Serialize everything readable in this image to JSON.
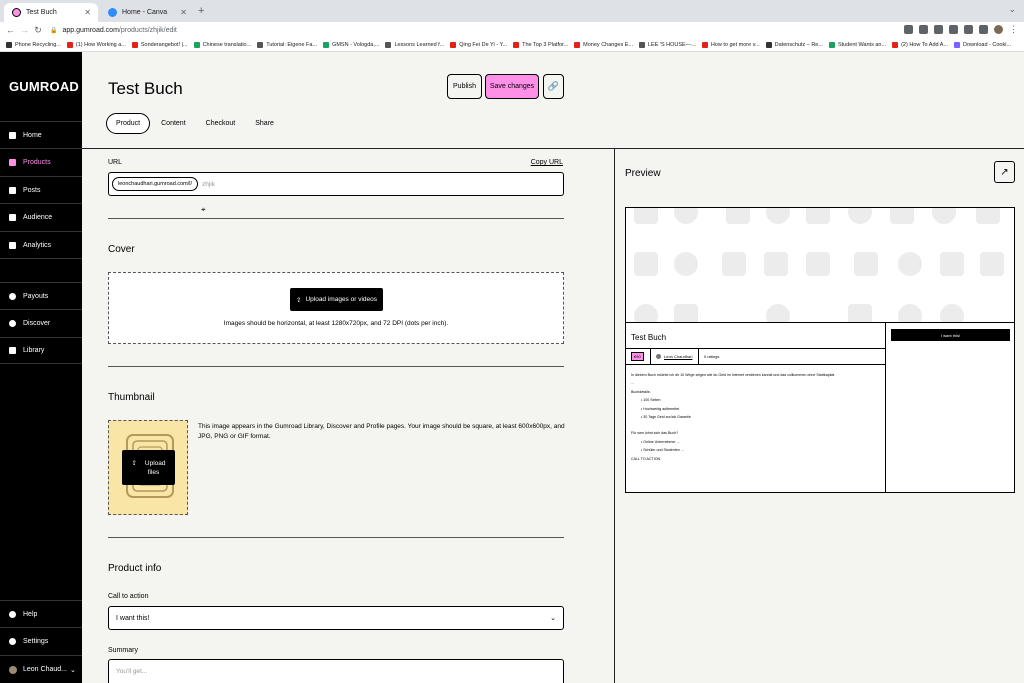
{
  "browser": {
    "tabs": [
      {
        "title": "Test Buch",
        "favicon_color": "#ff90e8"
      },
      {
        "title": "Home - Canva",
        "favicon_color": "#2d8cff"
      }
    ],
    "new_tab": "+",
    "url_host": "app.gumroad.com",
    "url_path": "/products/zhjik/edit",
    "bookmarks": [
      {
        "label": "Phone Recycling...",
        "color": "#333333"
      },
      {
        "label": "(1) How Working a...",
        "color": "#e62117"
      },
      {
        "label": "Sonderangebot! |...",
        "color": "#e62117"
      },
      {
        "label": "Chinese translatio...",
        "color": "#1aa260"
      },
      {
        "label": "Tutorial: Eigene Fa...",
        "color": "#555555"
      },
      {
        "label": "GMSN - Vologda,...",
        "color": "#1aa260"
      },
      {
        "label": "Lessons Learned f...",
        "color": "#555555"
      },
      {
        "label": "Qing Fei De Yi - Y...",
        "color": "#e62117"
      },
      {
        "label": "The Top 3 Platfor...",
        "color": "#e62117"
      },
      {
        "label": "Money Changes E...",
        "color": "#e62117"
      },
      {
        "label": "LEE 'S HOUSE—...",
        "color": "#555555"
      },
      {
        "label": "How to get more v...",
        "color": "#e62117"
      },
      {
        "label": "Datenschutz – Re...",
        "color": "#333333"
      },
      {
        "label": "Student Wants an...",
        "color": "#1aa260"
      },
      {
        "label": "(2) How To Add A...",
        "color": "#e62117"
      },
      {
        "label": "Download - Cooki...",
        "color": "#7b61ff"
      }
    ]
  },
  "sidebar": {
    "logo": "GUMROAD",
    "items": [
      {
        "label": "Home",
        "icon": "home-icon"
      },
      {
        "label": "Products",
        "icon": "products-icon",
        "active": true
      },
      {
        "label": "Posts",
        "icon": "posts-icon"
      },
      {
        "label": "Audience",
        "icon": "audience-icon"
      },
      {
        "label": "Analytics",
        "icon": "analytics-icon"
      },
      {
        "label": "Payouts",
        "icon": "payouts-icon"
      },
      {
        "label": "Discover",
        "icon": "search-icon"
      },
      {
        "label": "Library",
        "icon": "library-icon"
      }
    ],
    "help": "Help",
    "settings": "Settings",
    "user": "Leon Chaud..."
  },
  "header": {
    "title": "Test Buch",
    "publish": "Publish",
    "save": "Save changes",
    "tabs": [
      "Product",
      "Content",
      "Checkout",
      "Share"
    ],
    "active_tab": "Product"
  },
  "form": {
    "url_label": "URL",
    "copy_url": "Copy URL",
    "url_prefix": "leonchaudhari.gumroad.com/l/",
    "url_slug": "zhjik",
    "cover_heading": "Cover",
    "cover_button": "Upload images or videos",
    "cover_hint": "Images should be horizontal, at least 1280x720px, and 72 DPI (dots per inch).",
    "thumbnail_heading": "Thumbnail",
    "thumbnail_button_line1": "Upload",
    "thumbnail_button_line2": "files",
    "thumbnail_hint": "This image appears in the Gumroad Library, Discover and Profile pages. Your image should be square, at least 600x600px, and JPG, PNG or GIF format.",
    "product_info_heading": "Product info",
    "cta_label": "Call to action",
    "cta_value": "I want this!",
    "summary_label": "Summary",
    "summary_placeholder": "You'll get..."
  },
  "preview": {
    "title": "Preview",
    "product_title": "Test Buch",
    "price": "€90",
    "author": "Leon Chaudhari",
    "ratings": "0 ratings",
    "buy_button": "I want this!",
    "description": [
      {
        "text": "In diesem Buch möchte ich dir 10 Wege zeigen wie du Geld im Internet verdienen kannst und das vollkommen ohne Startkapital",
        "bullet": false
      },
      {
        "text": "...",
        "bullet": false
      },
      {
        "text": "Buchdetails:",
        "bullet": false
      },
      {
        "text": "100 Seiten",
        "bullet": true
      },
      {
        "text": "Hochwertig aufbereitet",
        "bullet": true
      },
      {
        "text": "30 Tage Geld zurück Garantie",
        "bullet": true
      },
      {
        "text": "Für wen lohnt sich das Buch?",
        "bullet": false
      },
      {
        "text": "Online Unternehmer ...",
        "bullet": true
      },
      {
        "text": "Schüler und Studenten ...",
        "bullet": true
      },
      {
        "text": "CALL TO ACTION",
        "bullet": false
      }
    ]
  }
}
